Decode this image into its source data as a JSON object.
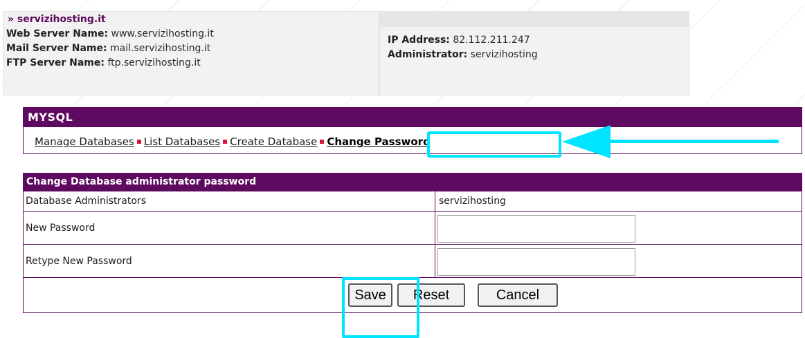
{
  "server_info": {
    "domain": "» servizihosting.it",
    "web_server_label": "Web Server Name:",
    "web_server_value": "www.servizihosting.it",
    "mail_server_label": "Mail Server Name:",
    "mail_server_value": "mail.servizihosting.it",
    "ftp_server_label": "FTP Server Name:",
    "ftp_server_value": "ftp.servizihosting.it",
    "ip_label": "IP Address:",
    "ip_value": "82.112.211.247",
    "admin_label": "Administrator:",
    "admin_value": "servizihosting"
  },
  "mysql": {
    "title": "MYSQL",
    "nav": [
      {
        "label": "Manage Databases"
      },
      {
        "label": "List Databases"
      },
      {
        "label": "Create Database"
      },
      {
        "label": "Change Password"
      }
    ]
  },
  "form": {
    "title": "Change Database administrator password",
    "rows": [
      {
        "label": "Database Administrators",
        "value": "servizihosting"
      },
      {
        "label": "New Password",
        "value": ""
      },
      {
        "label": "Retype New Password",
        "value": ""
      }
    ],
    "buttons": {
      "save": "Save",
      "reset": "Reset",
      "cancel": "Cancel"
    }
  },
  "colors": {
    "header_purple": "#5e0a61",
    "annotation_cyan": "#00e5ff",
    "separator_red": "#d9123a"
  }
}
